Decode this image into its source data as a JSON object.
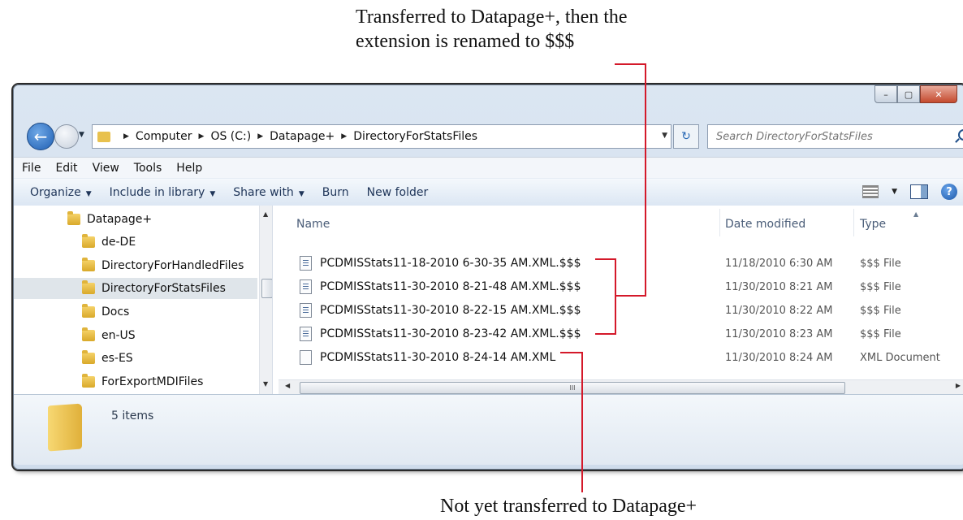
{
  "annotations": {
    "top_line1": "Transferred to Datapage+, then the",
    "top_line2": "extension is renamed to $$$",
    "bottom": "Not yet transferred to Datapage+"
  },
  "window": {
    "caption_buttons": {
      "minimize": "–",
      "maximize": "▢",
      "close": "✕"
    },
    "breadcrumb": [
      "Computer",
      "OS (C:)",
      "Datapage+",
      "DirectoryForStatsFiles"
    ],
    "search_placeholder": "Search DirectoryForStatsFiles",
    "menu": [
      "File",
      "Edit",
      "View",
      "Tools",
      "Help"
    ],
    "commands": {
      "organize": "Organize",
      "include": "Include in library",
      "share": "Share with",
      "burn": "Burn",
      "new_folder": "New folder"
    },
    "nav_tree": [
      {
        "label": "Datapage+",
        "selected": false
      },
      {
        "label": "de-DE",
        "selected": false
      },
      {
        "label": "DirectoryForHandledFiles",
        "selected": false
      },
      {
        "label": "DirectoryForStatsFiles",
        "selected": true
      },
      {
        "label": "Docs",
        "selected": false
      },
      {
        "label": "en-US",
        "selected": false
      },
      {
        "label": "es-ES",
        "selected": false
      },
      {
        "label": "ForExportMDIFiles",
        "selected": false
      }
    ],
    "columns": {
      "name": "Name",
      "date": "Date modified",
      "type": "Type"
    },
    "files": [
      {
        "name": "PCDMISStats11-18-2010 6-30-35 AM.XML.$$$",
        "date": "11/18/2010 6:30 AM",
        "type": "$$$ File",
        "icon": "sss-file-icon"
      },
      {
        "name": "PCDMISStats11-30-2010 8-21-48 AM.XML.$$$",
        "date": "11/30/2010 8:21 AM",
        "type": "$$$ File",
        "icon": "sss-file-icon"
      },
      {
        "name": "PCDMISStats11-30-2010 8-22-15 AM.XML.$$$",
        "date": "11/30/2010 8:22 AM",
        "type": "$$$ File",
        "icon": "sss-file-icon"
      },
      {
        "name": "PCDMISStats11-30-2010 8-23-42 AM.XML.$$$",
        "date": "11/30/2010 8:23 AM",
        "type": "$$$ File",
        "icon": "sss-file-icon"
      },
      {
        "name": "PCDMISStats11-30-2010 8-24-14 AM.XML",
        "date": "11/30/2010 8:24 AM",
        "type": "XML Document",
        "icon": "xml-file-icon"
      }
    ],
    "status": "5 items",
    "scroll_grip": "III"
  },
  "colors": {
    "annotation_line": "#d4192a",
    "selected_row": "#dfe5ea"
  }
}
